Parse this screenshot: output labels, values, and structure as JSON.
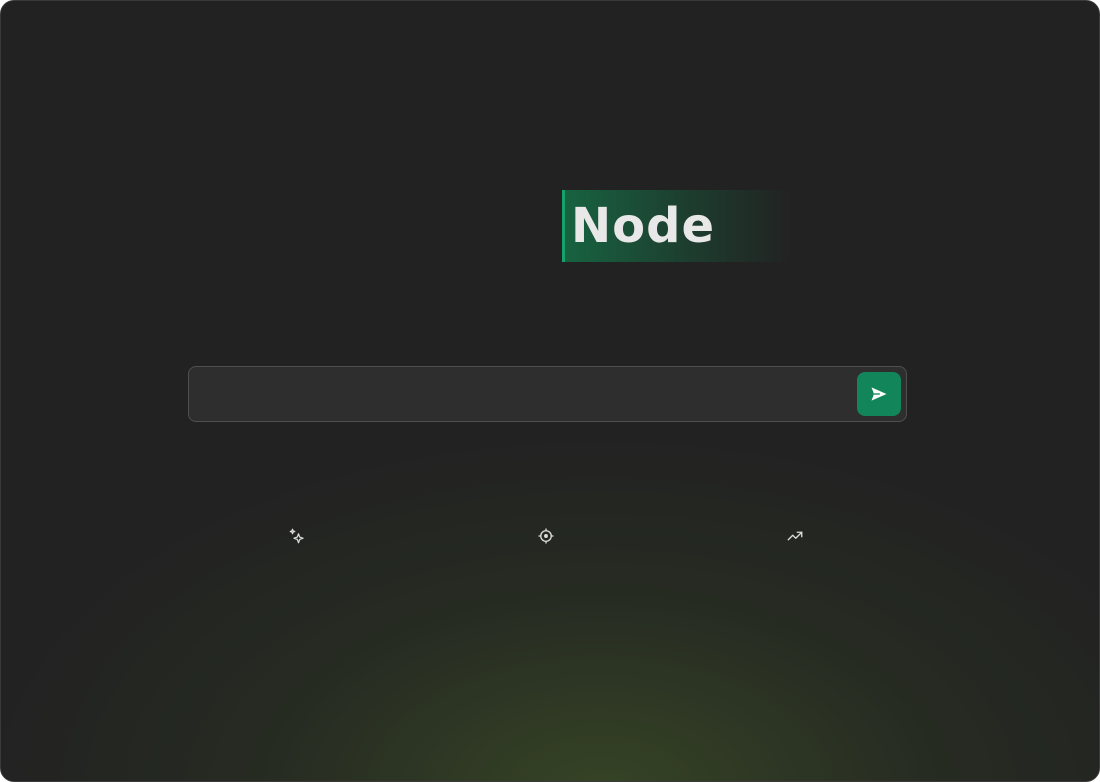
{
  "brand": {
    "title": "Node"
  },
  "search": {
    "value": "",
    "placeholder": "",
    "send_icon": "send-icon"
  },
  "features": [
    {
      "icon": "sparkles-icon",
      "label": ""
    },
    {
      "icon": "crosshair-icon",
      "label": ""
    },
    {
      "icon": "trending-up-icon",
      "label": ""
    }
  ],
  "colors": {
    "background": "#222222",
    "accent": "#12865a",
    "glow": "#465f28",
    "text": "#e8e8e8"
  }
}
